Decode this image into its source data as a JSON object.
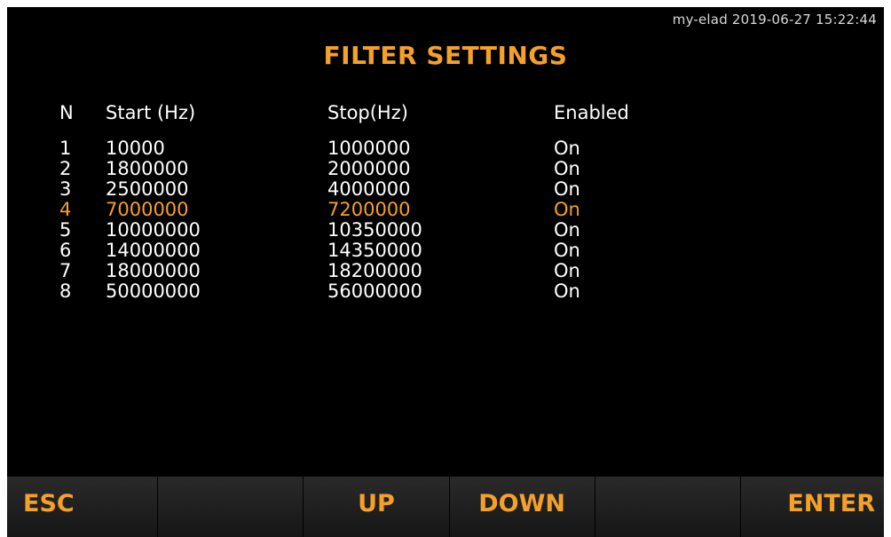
{
  "header": {
    "info": "my-elad 2019-06-27 15:22:44",
    "title": "FILTER SETTINGS"
  },
  "table": {
    "columns": [
      "N",
      "Start (Hz)",
      "Stop(Hz)",
      "Enabled"
    ],
    "rows": [
      {
        "n": "1",
        "start": "10000",
        "stop": "1000000",
        "enabled": "On"
      },
      {
        "n": "2",
        "start": "1800000",
        "stop": "2000000",
        "enabled": "On"
      },
      {
        "n": "3",
        "start": "2500000",
        "stop": "4000000",
        "enabled": "On"
      },
      {
        "n": "4",
        "start": "7000000",
        "stop": "7200000",
        "enabled": "On"
      },
      {
        "n": "5",
        "start": "10000000",
        "stop": "10350000",
        "enabled": "On"
      },
      {
        "n": "6",
        "start": "14000000",
        "stop": "14350000",
        "enabled": "On"
      },
      {
        "n": "7",
        "start": "18000000",
        "stop": "18200000",
        "enabled": "On"
      },
      {
        "n": "8",
        "start": "50000000",
        "stop": "56000000",
        "enabled": "On"
      }
    ],
    "selected_row": 4
  },
  "footer": {
    "buttons": [
      {
        "label": "ESC"
      },
      {
        "label": ""
      },
      {
        "label": "UP"
      },
      {
        "label": "DOWN"
      },
      {
        "label": ""
      },
      {
        "label": "ENTER"
      }
    ]
  },
  "colors": {
    "accent": "#f5a028",
    "background": "#000000",
    "text": "#ffffff"
  }
}
